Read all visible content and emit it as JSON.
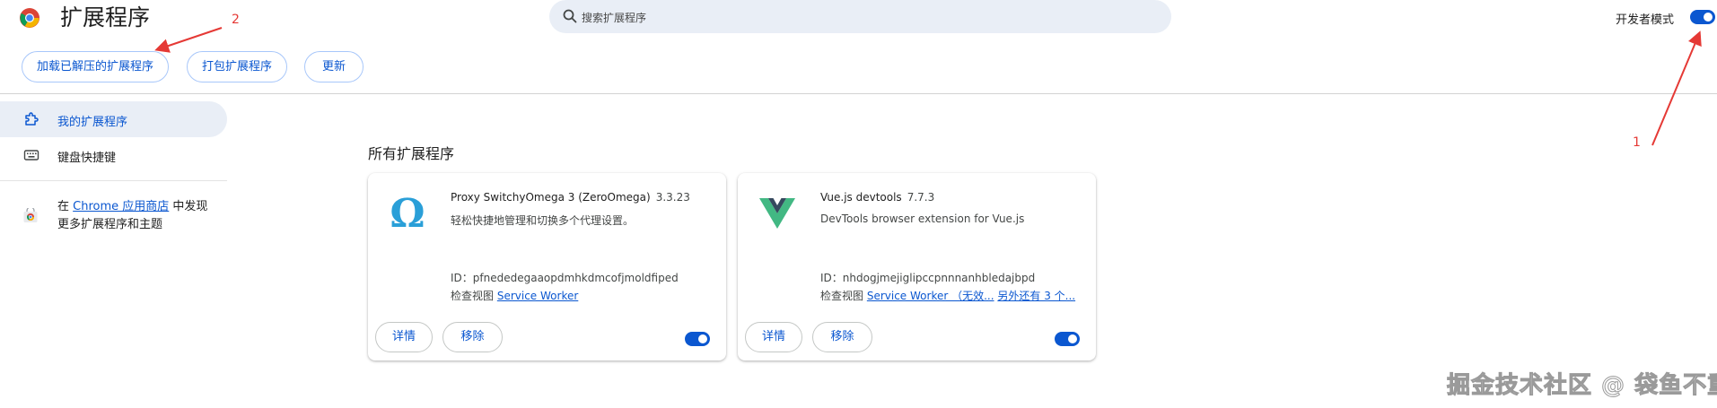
{
  "header": {
    "title": "扩展程序",
    "search_placeholder": "搜索扩展程序",
    "dev_mode_label": "开发者模式",
    "dev_mode_on": true
  },
  "toolbar": {
    "load_unpacked": "加载已解压的扩展程序",
    "pack": "打包扩展程序",
    "update": "更新"
  },
  "sidebar": {
    "items": [
      {
        "label": "我的扩展程序",
        "icon": "puzzle-icon",
        "active": true
      },
      {
        "label": "键盘快捷键",
        "icon": "keyboard-icon",
        "active": false
      }
    ],
    "store_prefix": "在",
    "store_link": "Chrome 应用商店",
    "store_suffix": "中发现更多扩展程序和主题"
  },
  "main": {
    "section_title": "所有扩展程序",
    "extensions": [
      {
        "name": "Proxy SwitchyOmega 3 (ZeroOmega)",
        "version": "3.3.23",
        "description": "轻松快捷地管理和切换多个代理设置。",
        "id_text": "ID：pfnededegaaopdmhkdmcofjmoldfiped",
        "inspect_label": "检查视图",
        "inspect_link": "Service Worker",
        "inspect_extra": "",
        "details": "详情",
        "remove": "移除",
        "enabled": true,
        "icon": "omega-icon"
      },
      {
        "name": "Vue.js devtools",
        "version": "7.7.3",
        "description": "DevTools browser extension for Vue.js",
        "id_text": "ID：nhdogjmejiglipccpnnnanhbledajbpd",
        "inspect_label": "检查视图",
        "inspect_link": "Service Worker （无效...",
        "inspect_extra": "另外还有 3 个...",
        "details": "详情",
        "remove": "移除",
        "enabled": true,
        "icon": "vue-icon"
      }
    ]
  },
  "annotations": {
    "num1": "1",
    "num2": "2",
    "watermark": "掘金技术社区 @ 袋鱼不重",
    "color": "#e53935"
  }
}
